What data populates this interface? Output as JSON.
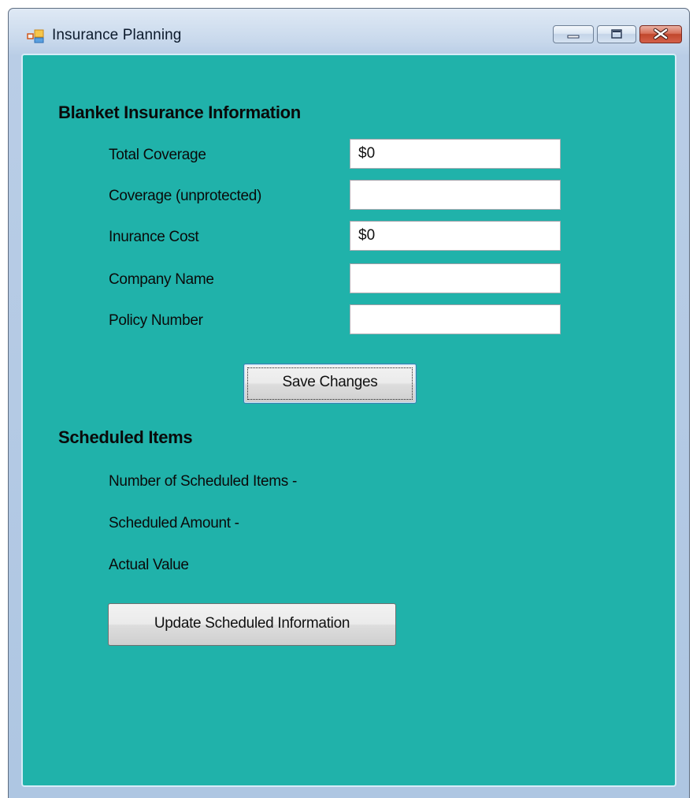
{
  "window": {
    "title": "Insurance Planning",
    "icon": "app-form-icon",
    "controls": [
      "minimize-icon",
      "maximize-icon",
      "close-icon"
    ],
    "client_bg": "#20b2aa"
  },
  "blanket": {
    "heading": "Blanket Insurance Information",
    "fields": [
      {
        "label": "Total Coverage",
        "value": "$0"
      },
      {
        "label": "Coverage (unprotected)",
        "value": ""
      },
      {
        "label": "Inurance Cost",
        "value": "$0"
      },
      {
        "label": "Company Name",
        "value": ""
      },
      {
        "label": "Policy Number",
        "value": ""
      }
    ],
    "save_label": "Save Changes"
  },
  "scheduled": {
    "heading": "Scheduled Items",
    "lines": [
      "Number of Scheduled Items -",
      "Scheduled Amount -",
      "Actual Value"
    ],
    "update_label": "Update Scheduled Information"
  }
}
